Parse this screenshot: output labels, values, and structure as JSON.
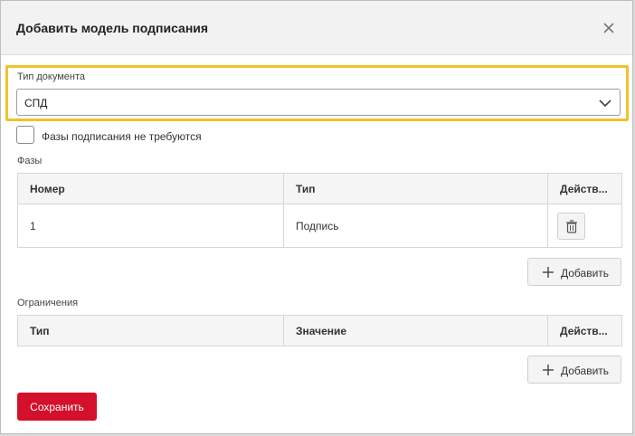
{
  "dialog": {
    "title": "Добавить модель подписания",
    "close_icon": "close-icon"
  },
  "doc_type": {
    "label": "Тип документа",
    "value": "СПД",
    "highlight_color": "#f2c12e"
  },
  "no_phases": {
    "label": "Фазы подписания не требуются",
    "checked": false
  },
  "phases": {
    "label": "Фазы",
    "columns": [
      "Номер",
      "Тип",
      "Действ..."
    ],
    "rows": [
      {
        "number": "1",
        "type": "Подпись",
        "action_icon": "trash-icon"
      }
    ],
    "add_label": "Добавить"
  },
  "restrictions": {
    "label": "Ограничения",
    "columns": [
      "Тип",
      "Значение",
      "Действ..."
    ],
    "rows": [],
    "add_label": "Добавить"
  },
  "footer": {
    "save_label": "Сохранить",
    "save_color": "#d4102b"
  }
}
